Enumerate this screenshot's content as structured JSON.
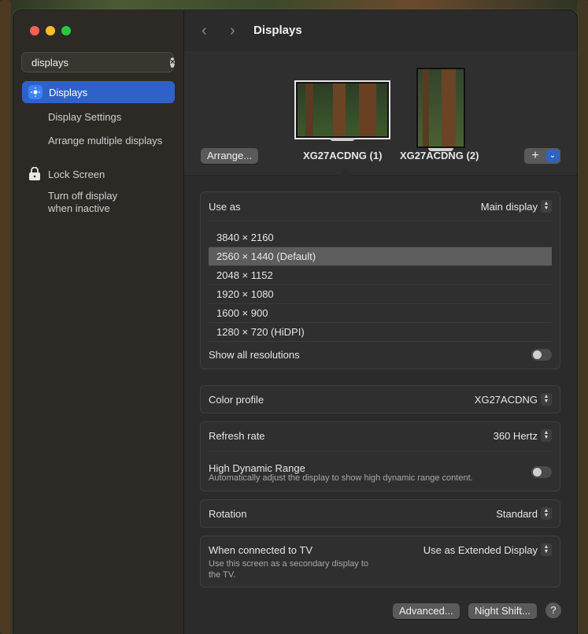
{
  "window": {
    "traffic_colors": [
      "#fe5f57",
      "#febc2e",
      "#28c840"
    ]
  },
  "sidebar": {
    "search_value": "displays",
    "selected_item": {
      "label": "Displays",
      "icon": "sun-icon"
    },
    "subitems_displays": [
      "Display Settings",
      "Arrange multiple displays"
    ],
    "lock_screen": {
      "label": "Lock Screen",
      "icon": "lock-screen-icon",
      "subitem_line1": "Turn off display",
      "subitem_line2": "when inactive"
    }
  },
  "header": {
    "title": "Displays",
    "back_icon": "chevron-left-icon",
    "forward_icon": "chevron-right-icon"
  },
  "arrangement": {
    "arrange_button": "Arrange...",
    "display1_label": "XG27ACDNG (1)",
    "display2_label": "XG27ACDNG (2)",
    "add_button": "+",
    "add_menu_icon": "chevron-down-icon"
  },
  "use_as": {
    "label": "Use as",
    "value": "Main display",
    "resolutions": [
      "3840 × 2160",
      "2560 × 1440 (Default)",
      "2048 × 1152",
      "1920 × 1080",
      "1600 × 900",
      "1280 × 720 (HiDPI)"
    ],
    "selected_resolution_index": 1,
    "show_all_label": "Show all resolutions",
    "show_all_on": false
  },
  "color_profile": {
    "label": "Color profile",
    "value": "XG27ACDNG"
  },
  "refresh": {
    "label": "Refresh rate",
    "value": "360 Hertz",
    "hdr_label": "High Dynamic Range",
    "hdr_desc": "Automatically adjust the display to show high dynamic range content.",
    "hdr_on": false
  },
  "rotation": {
    "label": "Rotation",
    "value": "Standard"
  },
  "tv": {
    "label": "When connected to TV",
    "value": "Use as Extended Display",
    "desc_line1": "Use this screen as a secondary display to",
    "desc_line2": "the TV."
  },
  "footer": {
    "advanced_button": "Advanced...",
    "night_shift_button": "Night Shift...",
    "help_button": "?"
  }
}
